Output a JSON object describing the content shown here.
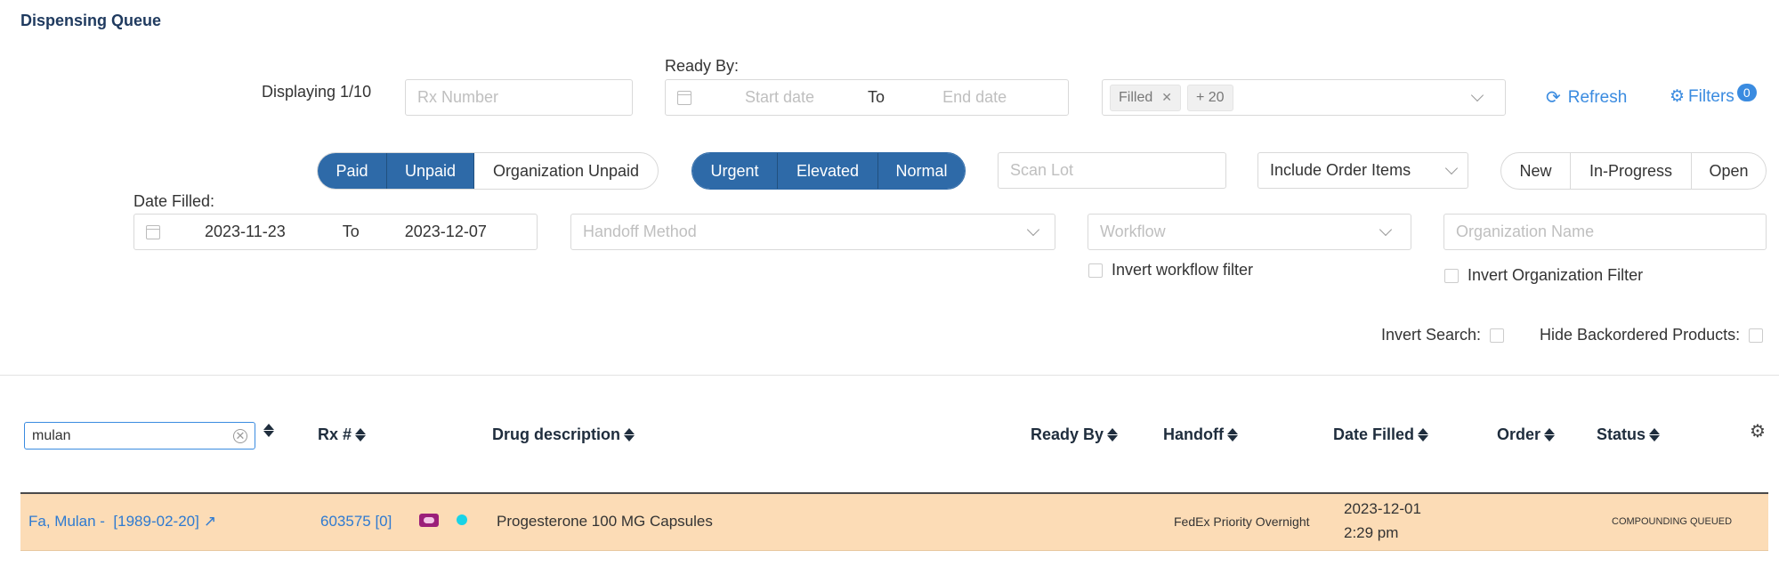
{
  "page": {
    "title": "Dispensing Queue"
  },
  "toolbar": {
    "displaying": "Displaying 1/10",
    "rx_number_placeholder": "Rx Number",
    "ready_by_label": "Ready By:",
    "start_date_placeholder": "Start date",
    "to_label": "To",
    "end_date_placeholder": "End date",
    "status_tags": [
      "Filled",
      "+ 20"
    ],
    "refresh_label": "Refresh",
    "filters_label": "Filters",
    "filters_count": "0"
  },
  "payment_toggle": [
    "Paid",
    "Unpaid",
    "Organization Unpaid"
  ],
  "priority_toggle": [
    "Urgent",
    "Elevated",
    "Normal"
  ],
  "scan_lot_placeholder": "Scan Lot",
  "include_order_items": "Include Order Items",
  "state_toggle": [
    "New",
    "In-Progress",
    "Open"
  ],
  "date_filled": {
    "label": "Date Filled:",
    "from": "2023-11-23",
    "to_label": "To",
    "to": "2023-12-07"
  },
  "handoff_placeholder": "Handoff Method",
  "workflow_placeholder": "Workflow",
  "invert_workflow_label": "Invert workflow filter",
  "org_name_placeholder": "Organization Name",
  "invert_org_label": "Invert Organization Filter",
  "invert_search_label": "Invert Search:",
  "hide_backordered_label": "Hide Backordered Products:",
  "table": {
    "search_value": "mulan",
    "headers": [
      "Rx #",
      "Drug description",
      "Ready By",
      "Handoff",
      "Date Filled",
      "Order",
      "Status"
    ],
    "rows": [
      {
        "patient": "Fa, Mulan -  [1989-02-20]",
        "rx": "603575 [0]",
        "drug": "Progesterone 100 MG Capsules",
        "ready_by": "",
        "handoff": "FedEx Priority Overnight",
        "date_filled_date": "2023-12-01",
        "date_filled_time": "2:29 pm",
        "order": "",
        "status": "COMPOUNDING QUEUED"
      }
    ]
  },
  "colors": {
    "accent": "#2e6aa8",
    "link": "#3a8be0",
    "row_highlight": "#fcdcb6",
    "status_dot": "#19d3e6",
    "pill_icon": "#9b1f7a"
  }
}
